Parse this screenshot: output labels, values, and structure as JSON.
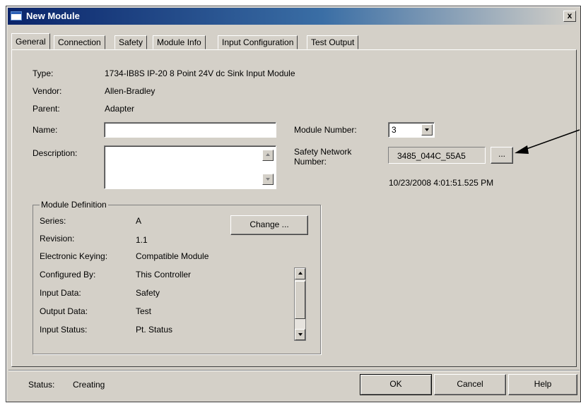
{
  "window": {
    "title": "New Module",
    "close_label": "x"
  },
  "tabs": [
    {
      "label": "General",
      "active": true
    },
    {
      "label": "Connection"
    },
    {
      "label": "Safety"
    },
    {
      "label": "Module Info"
    },
    {
      "label": "Input Configuration"
    },
    {
      "label": "Test Output"
    }
  ],
  "general": {
    "type_label": "Type:",
    "type_value": "1734-IB8S IP-20 8 Point 24V dc Sink Input Module",
    "vendor_label": "Vendor:",
    "vendor_value": "Allen-Bradley",
    "parent_label": "Parent:",
    "parent_value": "Adapter",
    "name_label": "Name:",
    "name_value": "",
    "description_label": "Description:",
    "description_value": "",
    "module_number_label": "Module Number:",
    "module_number_value": "3",
    "safety_network_label_1": "Safety Network",
    "safety_network_label_2": "Number:",
    "safety_network_value": "3485_044C_55A5",
    "browse_label": "...",
    "timestamp": "10/23/2008 4:01:51.525 PM"
  },
  "module_definition": {
    "title": "Module Definition",
    "change_label": "Change ...",
    "rows": [
      {
        "label": "Series:",
        "value": "A"
      },
      {
        "label": "Revision:",
        "value": "1.1"
      },
      {
        "label": "Electronic Keying:",
        "value": "Compatible Module"
      },
      {
        "label": "Configured By:",
        "value": "This Controller"
      },
      {
        "label": "Input Data:",
        "value": "Safety"
      },
      {
        "label": "Output Data:",
        "value": "Test"
      },
      {
        "label": "Input Status:",
        "value": "Pt. Status"
      }
    ]
  },
  "footer": {
    "status_label": "Status:",
    "status_value": "Creating",
    "ok_label": "OK",
    "cancel_label": "Cancel",
    "help_label": "Help"
  },
  "colors": {
    "dialog_face": "#d4d0c8",
    "title_gradient_start": "#0a246a",
    "title_gradient_end": "#3a6ea5"
  },
  "icons": [
    "window-icon",
    "close-icon",
    "chevron-down-icon",
    "arrow-up-icon",
    "arrow-down-icon",
    "callout-arrow"
  ]
}
